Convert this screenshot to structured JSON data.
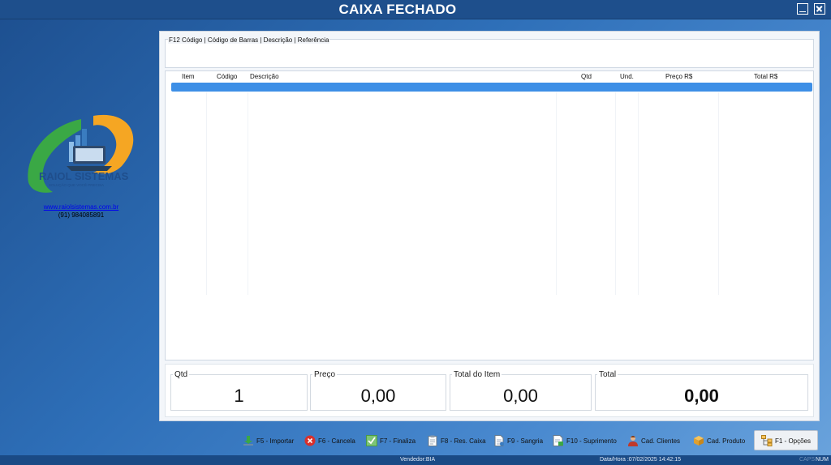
{
  "window": {
    "title": "CAIXA FECHADO"
  },
  "branding": {
    "company": "RAIOL SISTEMAS",
    "tagline": "SOLUÇÃO QUE VOCÊ PRECISA",
    "website": "www.raiolsistemas.com.br",
    "phone": "(91) 984085891",
    "colors": {
      "orange": "#f5a623",
      "green": "#3aa845",
      "blue": "#1f4e8c"
    }
  },
  "search": {
    "label": "F12  Código | Código de Barras | Descrição | Referência",
    "value": ""
  },
  "grid": {
    "columns": [
      "Item",
      "Código",
      "Descrição",
      "Qtd",
      "Und.",
      "Preço R$",
      "Total R$"
    ],
    "rows": [],
    "selection_color": "#3d8fe6"
  },
  "totals": {
    "qtd_label": "Qtd",
    "qtd_value": "1",
    "preco_label": "Preço",
    "preco_value": "0,00",
    "item_label": "Total do Item",
    "item_value": "0,00",
    "total_label": "Total",
    "total_value": "0,00"
  },
  "toolbar": {
    "importar": "F5 - Importar",
    "cancela": "F6 - Cancela",
    "finaliza": "F7 - Finaliza",
    "res_caixa": "F8 - Res. Caixa",
    "sangria": "F9 - Sangria",
    "suprimento": "F10 - Suprimento",
    "clientes": "Cad. Clientes",
    "produto": "Cad. Produto",
    "opcoes": "F1 - Opções"
  },
  "status": {
    "vendedor": "Vendedor:BIA",
    "datahora": "Data/Hora :07/02/2025 14:42:15",
    "caps": "CAPS",
    "num": "NUM"
  }
}
